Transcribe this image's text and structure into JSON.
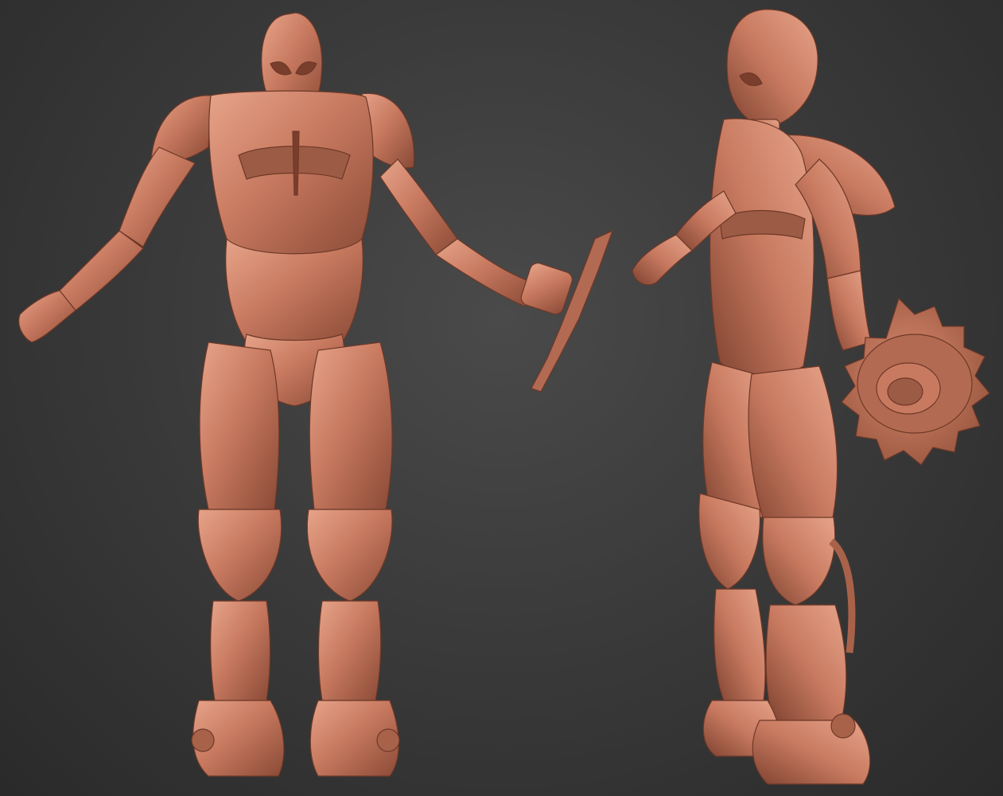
{
  "scene": {
    "background_color": "#3a3a3a",
    "material_color": "#c87a60",
    "material_shadow": "#8a4a36",
    "material_highlight": "#e6a48a"
  },
  "views": [
    {
      "name": "front-view",
      "subject": "armored-character-sculpt"
    },
    {
      "name": "three-quarter-view",
      "subject": "armored-character-sculpt"
    }
  ]
}
